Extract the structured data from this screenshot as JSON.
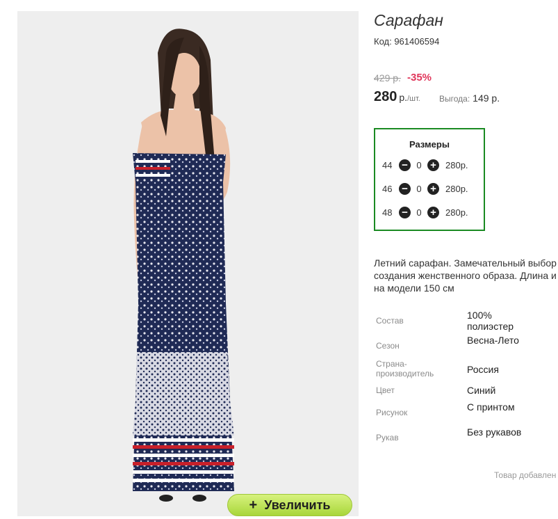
{
  "product": {
    "title": "Сарафан",
    "code": "Код: 961406594",
    "old_price": "429 р.",
    "discount": "-35%",
    "price_value": "280",
    "price_unit": "р.",
    "price_per": "/шт.",
    "savings_label": "Выгода:",
    "savings_value": "149 р."
  },
  "sizes": {
    "title": "Размеры",
    "rows": [
      {
        "size": "44",
        "qty": "0",
        "price": "280р."
      },
      {
        "size": "46",
        "qty": "0",
        "price": "280р."
      },
      {
        "size": "48",
        "qty": "0",
        "price": "280р."
      }
    ]
  },
  "description": {
    "line1": "Летний сарафан. Замечательный выбор",
    "line2": "создания женственного образа. Длина и",
    "line3": "на модели 150 см"
  },
  "attributes": [
    {
      "label": "Состав",
      "value": "100% полиэстер"
    },
    {
      "label": "Сезон",
      "value": "Весна-Лето"
    },
    {
      "label": "Страна-производитель",
      "value": "Россия"
    },
    {
      "label": "Цвет",
      "value": "Синий"
    },
    {
      "label": "Рисунок",
      "value": "С принтом"
    },
    {
      "label": "Рукав",
      "value": "Без рукавов"
    }
  ],
  "added_note": "Товар добавлен",
  "zoom_button": {
    "label": "Увеличить",
    "icon": "plus-icon"
  },
  "colors": {
    "accent_green": "#1a8a22",
    "discount_red": "#e0365a",
    "button_green": "#b5e04a"
  }
}
